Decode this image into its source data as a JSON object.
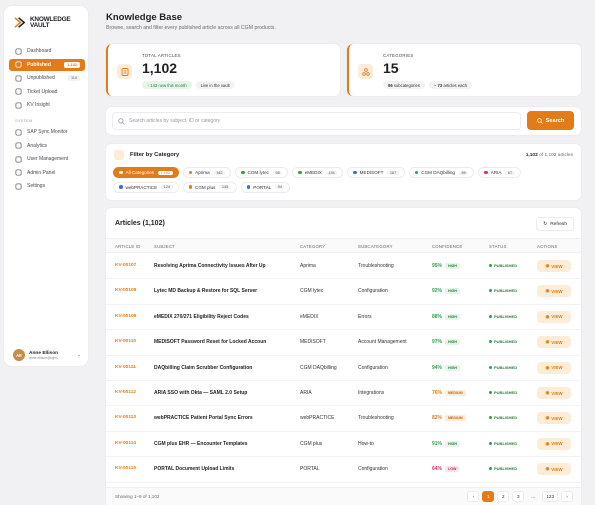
{
  "app": {
    "logo_line1": "KNOWLEDGE",
    "logo_line2": "VAULT"
  },
  "sidebar": {
    "items": [
      {
        "label": "Dashboard",
        "icon": "dashboard-icon"
      },
      {
        "label": "Published",
        "icon": "book-icon",
        "count": "1,102",
        "active": true
      },
      {
        "label": "Unpublished",
        "icon": "draft-icon",
        "count": "118"
      },
      {
        "label": "Ticket Upload",
        "icon": "upload-icon"
      },
      {
        "label": "KV Insight",
        "icon": "insight-icon"
      }
    ],
    "system_label": "SYSTEM",
    "system_items": [
      {
        "label": "SAP Sync Monitor",
        "icon": "sync-icon"
      },
      {
        "label": "Analytics",
        "icon": "analytics-icon"
      },
      {
        "label": "User Management",
        "icon": "users-icon"
      },
      {
        "label": "Admin Panel",
        "icon": "admin-icon"
      },
      {
        "label": "Settings",
        "icon": "gear-icon"
      }
    ],
    "user": {
      "initials": "AE",
      "name": "Anne Ellison",
      "email": "anne.ellison@cgm..."
    }
  },
  "header": {
    "title": "Knowledge Base",
    "subtitle": "Browse, search and filter every published article across all CGM products."
  },
  "stats": {
    "articles": {
      "label": "TOTAL ARTICLES",
      "value": "1,102",
      "chip1": "↑ 143  new this month",
      "chip2": "Live in the vault"
    },
    "categories": {
      "label": "CATEGORIES",
      "value": "15",
      "chip1_num": "96",
      "chip1_text": "subcategories",
      "chip2_num": "73",
      "chip2_text": "articles each",
      "chip2_prefix": "~"
    }
  },
  "search": {
    "placeholder": "Search articles by subject, ID or category",
    "button": "Search"
  },
  "filter": {
    "title": "Filter by Category",
    "count_bold": "1,102",
    "count_rest": "of 1,102 articles",
    "categories": [
      {
        "label": "All Categories",
        "count": "1,102",
        "color": "#ffffff",
        "active": true
      },
      {
        "label": "Aprima",
        "count": "142",
        "color": "#e27c18"
      },
      {
        "label": "CGM lytec",
        "count": "98",
        "color": "#2ea04f"
      },
      {
        "label": "eMEDIX",
        "count": "154",
        "color": "#2ea04f"
      },
      {
        "label": "MEDISOFT",
        "count": "187",
        "color": "#3b6fd6"
      },
      {
        "label": "CGM DAQbilling",
        "count": "89",
        "color": "#2ea04f"
      },
      {
        "label": "ARIA",
        "count": "67",
        "color": "#d6336c"
      },
      {
        "label": "webPRACTICE",
        "count": "124",
        "color": "#3b6fd6"
      },
      {
        "label": "CGM plus",
        "count": "145",
        "color": "#e27c18"
      },
      {
        "label": "PORTAL",
        "count": "94",
        "color": "#3b6fd6"
      }
    ]
  },
  "table": {
    "title": "Articles (1,102)",
    "refresh": "Refresh",
    "headers": [
      "ARTICLE ID",
      "SUBJECT",
      "CATEGORY",
      "SUBCATEGORY",
      "CONFIDENCE",
      "STATUS",
      "ACTIONS"
    ],
    "rows": [
      {
        "id": "KV-00107",
        "subject": "Resolving Aprima Connectivity Issues After Up",
        "category": "Aprima",
        "subcategory": "Troubleshooting",
        "confidence": "95%",
        "level": "HIGH",
        "status": "PUBLISHED",
        "action": "VIEW"
      },
      {
        "id": "KV-00108",
        "subject": "Lytec MD Backup & Restore for SQL Server",
        "category": "CGM lytec",
        "subcategory": "Configuration",
        "confidence": "92%",
        "level": "HIGH",
        "status": "PUBLISHED",
        "action": "VIEW"
      },
      {
        "id": "KV-00109",
        "subject": "eMEDIX 270/271 Eligibility Reject Codes",
        "category": "eMEDIX",
        "subcategory": "Errors",
        "confidence": "88%",
        "level": "HIGH",
        "status": "PUBLISHED",
        "action": "VIEW"
      },
      {
        "id": "KV-00110",
        "subject": "MEDISOFT Password Reset for Locked Accoun",
        "category": "MEDISOFT",
        "subcategory": "Account Management",
        "confidence": "97%",
        "level": "HIGH",
        "status": "PUBLISHED",
        "action": "VIEW"
      },
      {
        "id": "KV-00111",
        "subject": "DAQbilling Claim Scrubber Configuration",
        "category": "CGM DAQbilling",
        "subcategory": "Configuration",
        "confidence": "94%",
        "level": "HIGH",
        "status": "PUBLISHED",
        "action": "VIEW"
      },
      {
        "id": "KV-00112",
        "subject": "ARIA SSO with Okta — SAML 2.0 Setup",
        "category": "ARIA",
        "subcategory": "Integrations",
        "confidence": "76%",
        "level": "MEDIUM",
        "status": "PUBLISHED",
        "action": "VIEW"
      },
      {
        "id": "KV-00113",
        "subject": "webPRACTICE Patient Portal Sync Errors",
        "category": "webPRACTICE",
        "subcategory": "Troubleshooting",
        "confidence": "82%",
        "level": "MEDIUM",
        "status": "PUBLISHED",
        "action": "VIEW"
      },
      {
        "id": "KV-00114",
        "subject": "CGM plus EHR — Encounter Templates",
        "category": "CGM plus",
        "subcategory": "How-to",
        "confidence": "91%",
        "level": "HIGH",
        "status": "PUBLISHED",
        "action": "VIEW"
      },
      {
        "id": "KV-00115",
        "subject": "PORTAL Document Upload Limits",
        "category": "PORTAL",
        "subcategory": "Configuration",
        "confidence": "64%",
        "level": "LOW",
        "status": "PUBLISHED",
        "action": "VIEW"
      }
    ],
    "showing": "Showing 1–9 of 1,102",
    "pages": [
      "‹",
      "1",
      "2",
      "3",
      "…",
      "123",
      "›"
    ],
    "active_page": "1"
  },
  "colors": {
    "accent": "#e27c18",
    "high": "#2ea04f",
    "medium": "#e27c18",
    "low": "#d6336c"
  }
}
